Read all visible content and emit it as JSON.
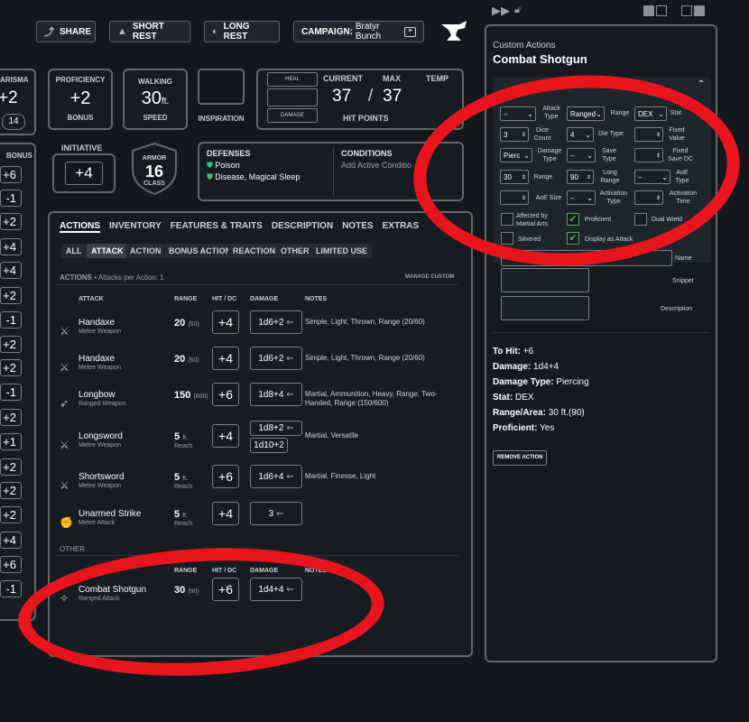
{
  "toolbar": {
    "share": "SHARE",
    "short_rest": "SHORT REST",
    "long_rest": "LONG REST",
    "campaign_label": "CAMPAIGN:",
    "campaign_name": "Bratyr Bunch"
  },
  "abilities": {
    "charisma_label": "ARISMA",
    "charisma_mod": "+2",
    "charisma_score": "14",
    "skill_bonus_label": "BONUS",
    "skill_bonuses": [
      "+6",
      "-1",
      "+2",
      "+4",
      "+4",
      "+2",
      "-1",
      "+2",
      "+2",
      "-1",
      "+2",
      "+1",
      "+2",
      "+2",
      "+2",
      "+4",
      "+6",
      "-1"
    ]
  },
  "stats": {
    "proficiency_label": "PROFICIENCY",
    "proficiency_value": "+2",
    "proficiency_sub": "BONUS",
    "walking_label": "WALKING",
    "walking_value": "30",
    "walking_unit": "ft.",
    "speed_label": "SPEED",
    "inspiration_label": "INSPIRATION",
    "heal_label": "HEAL",
    "damage_label": "DAMAGE",
    "current_label": "CURRENT",
    "max_label": "MAX",
    "temp_label": "TEMP",
    "current_hp": "37",
    "max_hp": "37",
    "hp_slash": "/",
    "hit_points_label": "HIT POINTS",
    "initiative_label": "INITIATIVE",
    "initiative_value": "+4",
    "armor_label": "ARMOR",
    "armor_value": "16",
    "class_label": "CLASS"
  },
  "defenses": {
    "title": "DEFENSES",
    "items": [
      "Poison",
      "Disease, Magical Sleep"
    ]
  },
  "conditions": {
    "title": "CONDITIONS",
    "placeholder": "Add Active Conditio"
  },
  "tabs": [
    "ACTIONS",
    "INVENTORY",
    "FEATURES & TRAITS",
    "DESCRIPTION",
    "NOTES",
    "EXTRAS"
  ],
  "subtabs": [
    "ALL",
    "ATTACK",
    "ACTION",
    "BONUS ACTION",
    "REACTION",
    "OTHER",
    "LIMITED USE"
  ],
  "actions_section": {
    "heading": "ACTIONS",
    "attacks_per_action": "• Attacks per Action: 1",
    "manage_custom": "MANAGE CUSTOM",
    "col_attack": "ATTACK",
    "col_range": "RANGE",
    "col_hit": "HIT / DC",
    "col_damage": "DAMAGE",
    "col_notes": "NOTES",
    "other_heading": "OTHER"
  },
  "attacks": [
    {
      "name": "Handaxe",
      "type": "Melee Weapon",
      "range": "20",
      "range_long": "(60)",
      "hit": "+4",
      "damage": "1d6+2",
      "notes": "Simple, Light, Thrown, Range (20/60)",
      "icon": "sword-icon"
    },
    {
      "name": "Handaxe",
      "type": "Melee Weapon",
      "range": "20",
      "range_long": "(60)",
      "hit": "+4",
      "damage": "1d6+2",
      "notes": "Simple, Light, Thrown, Range (20/60)",
      "icon": "sword-icon"
    },
    {
      "name": "Longbow",
      "type": "Ranged Weapon",
      "range": "150",
      "range_long": "(600)",
      "hit": "+6",
      "damage": "1d8+4",
      "notes": "Martial, Ammunition, Heavy, Range, Two-Handed, Range (150/600)",
      "icon": "bow-icon"
    },
    {
      "name": "Longsword",
      "type": "Melee Weapon",
      "range": "5",
      "range_unit": "ft.",
      "range_sub": "Reach",
      "hit": "+4",
      "damage": "1d8+2",
      "damage2": "1d10+2",
      "notes": "Martial, Versatile",
      "icon": "sword-icon"
    },
    {
      "name": "Shortsword",
      "type": "Melee Weapon",
      "range": "5",
      "range_unit": "ft.",
      "range_sub": "Reach",
      "hit": "+6",
      "damage": "1d6+4",
      "notes": "Martial, Finesse, Light",
      "icon": "sword-icon"
    },
    {
      "name": "Unarmed Strike",
      "type": "Melee Attack",
      "range": "5",
      "range_unit": "ft.",
      "range_sub": "Reach",
      "hit": "+4",
      "damage": "3",
      "notes": "",
      "icon": "fist-icon"
    }
  ],
  "other_attack": {
    "name": "Combat Shotgun",
    "type": "Ranged Attack",
    "range": "30",
    "range_long": "(90)",
    "hit": "+6",
    "damage": "1d4+4"
  },
  "panel": {
    "subtitle": "Custom Actions",
    "title": "Combat Shotgun",
    "attack_type_label": "Attack Type",
    "attack_type_value": "Ranged",
    "range_label": "Range",
    "stat_value": "DEX",
    "stat_label": "Stat",
    "dice_count_label": "Dice Count",
    "dice_count_value": "3",
    "die_type_value": "4",
    "die_type_label": "Die Type",
    "fixed_value_label": "Fixed Value",
    "damage_type_value": "Pierc",
    "damage_type_label": "Damage Type",
    "save_type_label": "Save Type",
    "fixed_save_label": "Fixed Save DC",
    "range_value": "30",
    "range2_label": "Range",
    "long_range_value": "90",
    "long_range_label": "Long Range",
    "aoe_type_label": "AoE Type",
    "aoe_size_label": "AoE Size",
    "activation_type_label": "Activation Type",
    "activation_time_label": "Activation Time",
    "dash": "–",
    "affected_label": "Affected by Martial Arts",
    "proficient_label": "Proficient",
    "dual_wield_label": "Dual Wield",
    "silvered_label": "Silvered",
    "display_attack_label": "Display as Attack",
    "name_value": "t Shotgun",
    "name_label": "Name",
    "snippet_label": "Snippet",
    "description_label": "Description",
    "summary": [
      {
        "k": "To Hit:",
        "v": "+6"
      },
      {
        "k": "Damage:",
        "v": "1d4+4"
      },
      {
        "k": "Damage Type:",
        "v": "Piercing"
      },
      {
        "k": "Stat:",
        "v": "DEX"
      },
      {
        "k": "Range/Area:",
        "v": "30 ft.(90)"
      },
      {
        "k": "Proficient:",
        "v": "Yes"
      }
    ],
    "remove_button": "REMOVE ACTION"
  },
  "colors": {
    "annotation_red": "#e8161c",
    "check_green": "#4fae4f",
    "shield_green": "#3fbf7f"
  }
}
